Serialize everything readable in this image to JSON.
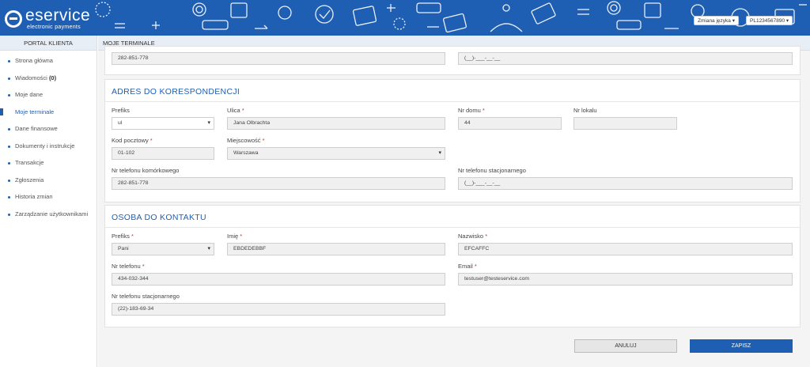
{
  "brand": {
    "name": "eservice",
    "tagline": "electronic payments"
  },
  "header": {
    "language_button": "Zmiana języka",
    "account_button": "PL1234567890"
  },
  "colors": {
    "brand_blue": "#1f5fb3",
    "required": "#c0392b"
  },
  "sidebar": {
    "title": "PORTAL KLIENTA",
    "items": [
      {
        "label": "Strona główna"
      },
      {
        "label": "Wiadomości",
        "count": "(0)"
      },
      {
        "label": "Moje dane"
      },
      {
        "label": "Moje terminale",
        "active": true
      },
      {
        "label": "Dane finansowe"
      },
      {
        "label": "Dokumenty i instrukcje"
      },
      {
        "label": "Transakcje"
      },
      {
        "label": "Zgłoszenia"
      },
      {
        "label": "Historia zmian"
      },
      {
        "label": "Zarządzanie użytkownikami"
      }
    ]
  },
  "page_title": "MOJE TERMINALE",
  "top_panel": {
    "mobile_value": "282-851-778",
    "landline_placeholder": "(__)-___-__-__"
  },
  "address": {
    "title": "ADRES DO KORESPONDENCJI",
    "prefix_label": "Prefiks",
    "prefix_value": "ul",
    "street_label": "Ulica",
    "street_value": "Jana Olbrachta",
    "house_label": "Nr domu",
    "house_value": "44",
    "flat_label": "Nr lokalu",
    "flat_value": "",
    "postal_label": "Kod pocztowy",
    "postal_value": "01-102",
    "city_label": "Miejscowość",
    "city_value": "Warszawa",
    "mobile_label": "Nr telefonu komórkowego",
    "mobile_value": "282-851-778",
    "landline_label": "Nr telefonu stacjonarnego",
    "landline_value": "(__)-___-__-__"
  },
  "contact": {
    "title": "OSOBA DO KONTAKTU",
    "prefix_label": "Prefiks",
    "prefix_value": "Pani",
    "name_label": "Imię",
    "name_value": "EBDEDEBBF",
    "surname_label": "Nazwisko",
    "surname_value": "EFCAFFC",
    "phone_label": "Nr telefonu",
    "phone_value": "434-032-344",
    "email_label": "Email",
    "email_value": "testuser@testeservice.com",
    "landline_label": "Nr telefonu stacjonarnego",
    "landline_value": "(22)-183-69-34"
  },
  "actions": {
    "cancel": "ANULUJ",
    "save": "ZAPISZ"
  }
}
